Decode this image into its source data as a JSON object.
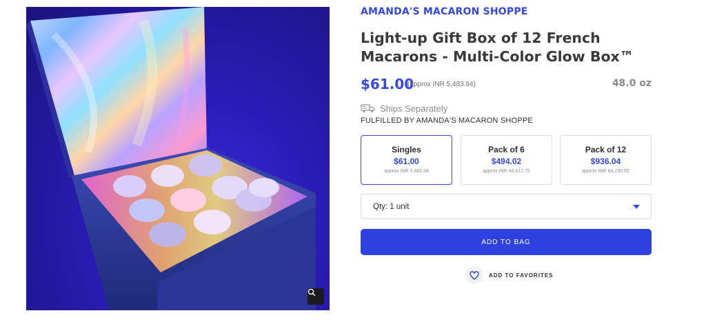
{
  "product_image": {
    "alt": "Light-up gift box of macarons glowing with multicolor lights"
  },
  "brand": "AMANDA'S MACARON SHOPPE",
  "title": "Light-up Gift Box of 12 French Macarons - Multi-Color Glow Box™",
  "price": "$61.00",
  "price_approx": "(approx INR 5,483.94)",
  "weight": "48.0 oz",
  "shipping": {
    "icon": "truck-icon",
    "label": "Ships Separately"
  },
  "fulfilled_by": "FULFILLED BY AMANDA'S MACARON SHOPPE",
  "options": [
    {
      "name": "Singles",
      "price": "$61.00",
      "approx": "approx INR 5,483.94",
      "selected": true
    },
    {
      "name": "Pack of 6",
      "price": "$494.02",
      "approx": "approx INR 44,412.75",
      "selected": false
    },
    {
      "name": "Pack of 12",
      "price": "$936.04",
      "approx": "approx INR 84,150.65",
      "selected": false
    }
  ],
  "quantity": {
    "label": "Qty: 1 unit",
    "icon": "chevron-down-icon"
  },
  "add_to_bag_label": "ADD TO BAG",
  "favorites": {
    "icon": "heart-icon",
    "label": "ADD TO FAVORITES"
  },
  "zoom": {
    "icon": "magnifier-icon"
  },
  "colors": {
    "accent": "#3446e3",
    "button": "#2f41e0",
    "text": "#3a3a3a",
    "muted": "#8a8a8a"
  }
}
